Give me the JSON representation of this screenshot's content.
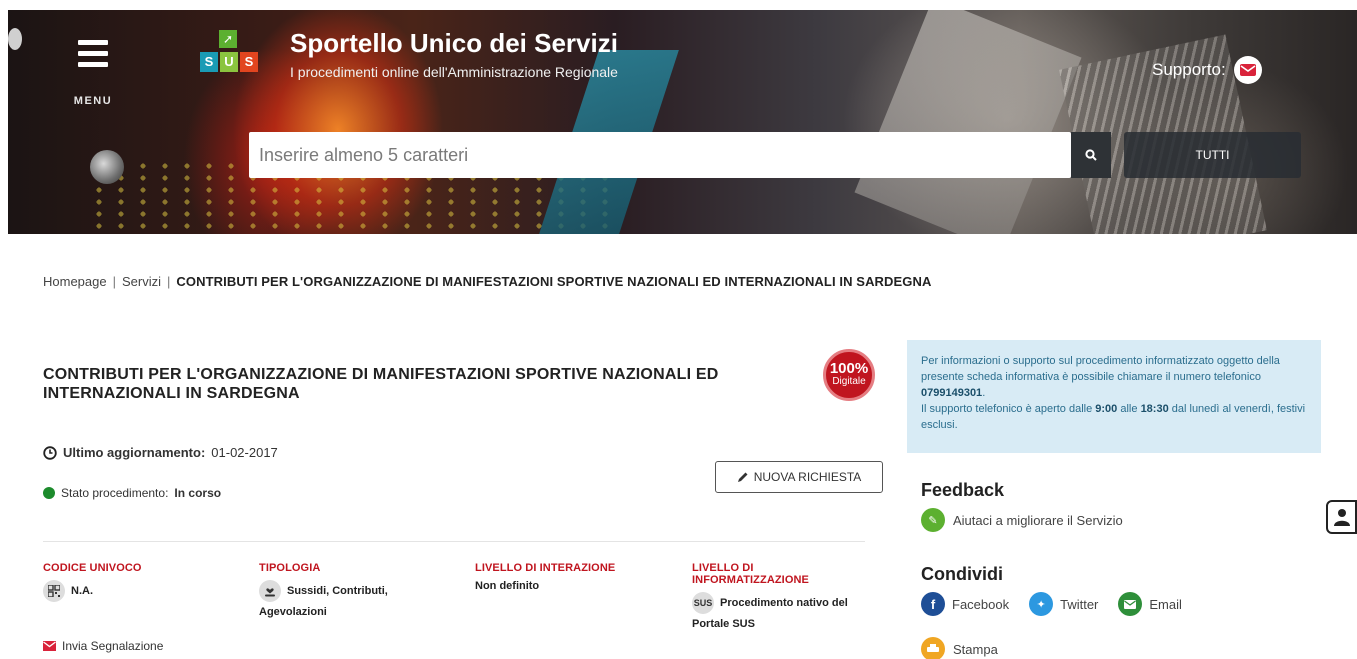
{
  "header": {
    "menu_label": "MENU",
    "logo_letters": [
      "S",
      "U",
      "S"
    ],
    "title": "Sportello Unico dei Servizi",
    "subtitle": "I procedimenti online dell'Amministrazione Regionale",
    "support_label": "Supporto:",
    "search_placeholder": "Inserire almeno 5 caratteri",
    "filter_label": "TUTTI"
  },
  "breadcrumb": {
    "home": "Homepage",
    "services": "Servizi",
    "current": "CONTRIBUTI PER L'ORGANIZZAZIONE DI MANIFESTAZIONI SPORTIVE NAZIONALI ED INTERNAZIONALI IN SARDEGNA"
  },
  "main": {
    "title_line1": "CONTRIBUTI PER L'ORGANIZZAZIONE DI MANIFESTAZIONI SPORTIVE NAZIONALI ED",
    "title_line2": "INTERNAZIONALI IN SARDEGNA",
    "badge_pct": "100%",
    "badge_label": "Digitale",
    "updated_label": "Ultimo aggiornamento:",
    "updated_value": "01-02-2017",
    "status_label": "Stato procedimento:",
    "status_value": "In corso",
    "new_request_label": "NUOVA RICHIESTA",
    "columns": [
      {
        "heading": "CODICE UNIVOCO",
        "value": "N.A."
      },
      {
        "heading": "TIPOLOGIA",
        "value": "Sussidi, Contributi, Agevolazioni"
      },
      {
        "heading": "LIVELLO DI INTERAZIONE",
        "value": "Non definito"
      },
      {
        "heading": "LIVELLO DI INFORMATIZZAZIONE",
        "value": "Procedimento nativo del Portale SUS",
        "icon_text": "SUS"
      }
    ],
    "report_label": "Invia Segnalazione"
  },
  "sidebar": {
    "info": {
      "text1": "Per informazioni o supporto sul procedimento informatizzato oggetto della presente scheda informativa è possibile chiamare il numero telefonico ",
      "phone": "0799149301",
      "text2": ".",
      "text3": "Il supporto telefonico è aperto dalle ",
      "open": "9:00",
      "text4": " alle ",
      "close": "18:30",
      "text5": " dal lunedì al venerdì, festivi esclusi."
    },
    "feedback_heading": "Feedback",
    "feedback_link": "Aiutaci a migliorare il Servizio",
    "share_heading": "Condividi",
    "share": {
      "facebook": "Facebook",
      "twitter": "Twitter",
      "email": "Email",
      "print": "Stampa"
    }
  },
  "colors": {
    "accent_red": "#c0151f",
    "status_green": "#1c8b2c",
    "info_bg": "#d8ebf5"
  }
}
